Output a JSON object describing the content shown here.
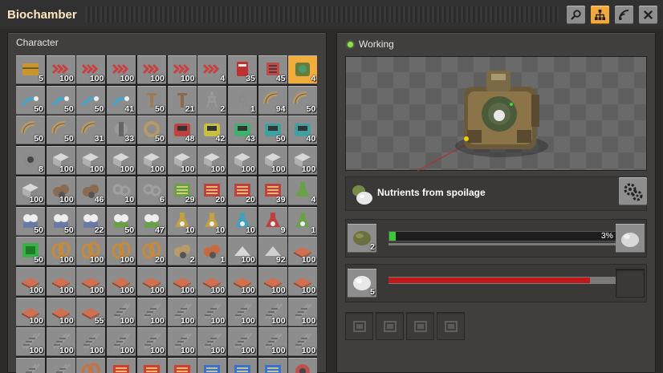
{
  "window": {
    "title": "Biochamber",
    "buttons": [
      {
        "name": "search-button",
        "icon": "magnifier-icon"
      },
      {
        "name": "circuit-network-button",
        "icon": "network-icon",
        "active": true
      },
      {
        "name": "logistics-button",
        "icon": "signal-icon"
      },
      {
        "name": "close-button",
        "icon": "close-icon"
      }
    ]
  },
  "inventory": {
    "title": "Character",
    "slots": [
      {
        "icon": "wooden-chest",
        "color": "#c9962e",
        "count": "5"
      },
      {
        "icon": "transport-belt",
        "color": "#c84040",
        "count": "100"
      },
      {
        "icon": "transport-belt",
        "color": "#c84040",
        "count": "100"
      },
      {
        "icon": "transport-belt",
        "color": "#c84040",
        "count": "100"
      },
      {
        "icon": "transport-belt",
        "color": "#c84040",
        "count": "100"
      },
      {
        "icon": "transport-belt",
        "color": "#c84040",
        "count": "100"
      },
      {
        "icon": "transport-belt",
        "color": "#c84040",
        "count": "4"
      },
      {
        "icon": "splitter",
        "color": "#c03030",
        "count": "35"
      },
      {
        "icon": "underground-belt",
        "color": "#c04a4a",
        "count": "45"
      },
      {
        "icon": "biochamber",
        "color": "#4a9a6a",
        "count": "4",
        "highlight": true
      },
      {
        "icon": "fast-inserter",
        "color": "#3aa8d8",
        "count": "50"
      },
      {
        "icon": "fast-inserter",
        "color": "#3aa8d8",
        "count": "50"
      },
      {
        "icon": "fast-inserter",
        "color": "#3aa8d8",
        "count": "50"
      },
      {
        "icon": "fast-inserter",
        "color": "#3aa8d8",
        "count": "41"
      },
      {
        "icon": "pole",
        "color": "#a07a50",
        "count": "50"
      },
      {
        "icon": "pole",
        "color": "#8a6a48",
        "count": "21"
      },
      {
        "icon": "big-pole",
        "color": "#9a9a9a",
        "count": "2"
      },
      {
        "icon": "big-pole",
        "color": "#8a8a8a",
        "count": "1"
      },
      {
        "icon": "pipe",
        "color": "#b89a68",
        "count": "94"
      },
      {
        "icon": "pipe",
        "color": "#b89a68",
        "count": "50"
      },
      {
        "icon": "pipe",
        "color": "#b89a68",
        "count": "50"
      },
      {
        "icon": "pipe",
        "color": "#b89a68",
        "count": "50"
      },
      {
        "icon": "pipe",
        "color": "#b89a68",
        "count": "31"
      },
      {
        "icon": "pump",
        "color": "#9a9a9a",
        "count": "33"
      },
      {
        "icon": "pipe-ring",
        "color": "#b89a68",
        "count": "50"
      },
      {
        "icon": "assembler",
        "color": "#c04040",
        "count": "48"
      },
      {
        "icon": "assembler",
        "color": "#c8c040",
        "count": "42"
      },
      {
        "icon": "assembler",
        "color": "#40b070",
        "count": "43"
      },
      {
        "icon": "assembler",
        "color": "#40a0a0",
        "count": "50"
      },
      {
        "icon": "assembler",
        "color": "#40a0a0",
        "count": "40"
      },
      {
        "icon": "machine",
        "color": "#8a8a8a",
        "count": "8"
      },
      {
        "icon": "stone-block",
        "color": "#b0b0b0",
        "count": "100"
      },
      {
        "icon": "stone-block",
        "color": "#b0b0b0",
        "count": "100"
      },
      {
        "icon": "stone-block",
        "color": "#b0b0b0",
        "count": "100"
      },
      {
        "icon": "stone-block",
        "color": "#b0b0b0",
        "count": "100"
      },
      {
        "icon": "stone-block",
        "color": "#b0b0b0",
        "count": "100"
      },
      {
        "icon": "stone-block",
        "color": "#b0b0b0",
        "count": "100"
      },
      {
        "icon": "stone-block",
        "color": "#b0b0b0",
        "count": "100"
      },
      {
        "icon": "stone-block",
        "color": "#b0b0b0",
        "count": "100"
      },
      {
        "icon": "stone-block",
        "color": "#b0b0b0",
        "count": "100"
      },
      {
        "icon": "stone-block",
        "color": "#b0b0b0",
        "count": "100"
      },
      {
        "icon": "ore-pile",
        "color": "#8a6a50",
        "count": "100"
      },
      {
        "icon": "ore-pile",
        "color": "#8a6a50",
        "count": "46"
      },
      {
        "icon": "gears",
        "color": "#a0a0a0",
        "count": "10"
      },
      {
        "icon": "gears",
        "color": "#a0a0a0",
        "count": "6"
      },
      {
        "icon": "circuit",
        "color": "#6aa048",
        "count": "29"
      },
      {
        "icon": "circuit",
        "color": "#c04040",
        "count": "20"
      },
      {
        "icon": "circuit",
        "color": "#c04040",
        "count": "20"
      },
      {
        "icon": "circuit",
        "color": "#c04040",
        "count": "39"
      },
      {
        "icon": "science",
        "color": "#6aa048",
        "count": "4"
      },
      {
        "icon": "gear-pack",
        "color": "#6a7aa8",
        "count": "50"
      },
      {
        "icon": "gear-pack",
        "color": "#6a7aa8",
        "count": "50"
      },
      {
        "icon": "gear-pack",
        "color": "#6a7aa8",
        "count": "22"
      },
      {
        "icon": "gear-pack",
        "color": "#6aa048",
        "count": "50"
      },
      {
        "icon": "gear-pack",
        "color": "#6aa048",
        "count": "47"
      },
      {
        "icon": "flask",
        "color": "#c0a040",
        "count": "10"
      },
      {
        "icon": "flask",
        "color": "#c0a040",
        "count": "10"
      },
      {
        "icon": "flask",
        "color": "#40a0c0",
        "count": "10"
      },
      {
        "icon": "flask",
        "color": "#c04040",
        "count": "9"
      },
      {
        "icon": "flask",
        "color": "#6aa048",
        "count": "1"
      },
      {
        "icon": "module",
        "color": "#3ab048",
        "count": "50"
      },
      {
        "icon": "copper-cable",
        "color": "#c88a3a",
        "count": "100"
      },
      {
        "icon": "copper-cable",
        "color": "#c88a3a",
        "count": "100"
      },
      {
        "icon": "copper-cable",
        "color": "#c88a3a",
        "count": "100"
      },
      {
        "icon": "copper-cable",
        "color": "#c88a3a",
        "count": "20"
      },
      {
        "icon": "ore-pile",
        "color": "#b89a68",
        "count": "2"
      },
      {
        "icon": "ore-pile",
        "color": "#c86a40",
        "count": "1"
      },
      {
        "icon": "powder",
        "color": "#d8d8d8",
        "count": "100"
      },
      {
        "icon": "powder",
        "color": "#d0d0d0",
        "count": "92"
      },
      {
        "icon": "plate",
        "color": "#d07050",
        "count": "100"
      },
      {
        "icon": "plate",
        "color": "#d07050",
        "count": "100"
      },
      {
        "icon": "plate",
        "color": "#d07050",
        "count": "100"
      },
      {
        "icon": "plate",
        "color": "#d07050",
        "count": "100"
      },
      {
        "icon": "plate",
        "color": "#d07050",
        "count": "100"
      },
      {
        "icon": "plate",
        "color": "#d07050",
        "count": "100"
      },
      {
        "icon": "plate",
        "color": "#d07050",
        "count": "100"
      },
      {
        "icon": "plate",
        "color": "#d07050",
        "count": "100"
      },
      {
        "icon": "plate",
        "color": "#d07050",
        "count": "100"
      },
      {
        "icon": "plate",
        "color": "#d07050",
        "count": "100"
      },
      {
        "icon": "plate",
        "color": "#d07050",
        "count": "100"
      },
      {
        "icon": "plate",
        "color": "#d07050",
        "count": "100"
      },
      {
        "icon": "plate",
        "color": "#d07050",
        "count": "100"
      },
      {
        "icon": "plate",
        "color": "#d07050",
        "count": "55"
      },
      {
        "icon": "rail",
        "color": "#9a9a9a",
        "count": "100"
      },
      {
        "icon": "rail",
        "color": "#9a9a9a",
        "count": "100"
      },
      {
        "icon": "rail",
        "color": "#9a9a9a",
        "count": "100"
      },
      {
        "icon": "rail",
        "color": "#9a9a9a",
        "count": "100"
      },
      {
        "icon": "rail",
        "color": "#9a9a9a",
        "count": "100"
      },
      {
        "icon": "rail",
        "color": "#9a9a9a",
        "count": "100"
      },
      {
        "icon": "rail",
        "color": "#9a9a9a",
        "count": "100"
      },
      {
        "icon": "rail",
        "color": "#9a9a9a",
        "count": "100"
      },
      {
        "icon": "rail",
        "color": "#9a9a9a",
        "count": "100"
      },
      {
        "icon": "rail",
        "color": "#9a9a9a",
        "count": "100"
      },
      {
        "icon": "rail",
        "color": "#9a9a9a",
        "count": "100"
      },
      {
        "icon": "rail",
        "color": "#9a9a9a",
        "count": "100"
      },
      {
        "icon": "rail",
        "color": "#9a9a9a",
        "count": "100"
      },
      {
        "icon": "rail",
        "color": "#9a9a9a",
        "count": "100"
      },
      {
        "icon": "rail",
        "color": "#9a9a9a",
        "count": "100"
      },
      {
        "icon": "rail",
        "color": "#9a9a9a",
        "count": "100"
      },
      {
        "icon": "rail",
        "color": "#9a9a9a",
        "count": "100"
      },
      {
        "icon": "rail",
        "color": "#9a9a9a",
        "count": ""
      },
      {
        "icon": "rail",
        "color": "#9a9a9a",
        "count": ""
      },
      {
        "icon": "copper-cable",
        "color": "#c87040",
        "count": ""
      },
      {
        "icon": "circuit",
        "color": "#d04030",
        "count": ""
      },
      {
        "icon": "circuit",
        "color": "#d04030",
        "count": ""
      },
      {
        "icon": "circuit",
        "color": "#d04030",
        "count": ""
      },
      {
        "icon": "circuit",
        "color": "#3a70d0",
        "count": ""
      },
      {
        "icon": "circuit",
        "color": "#3a70d0",
        "count": ""
      },
      {
        "icon": "circuit",
        "color": "#3a70d0",
        "count": ""
      },
      {
        "icon": "machine",
        "color": "#c05050",
        "count": ""
      }
    ]
  },
  "machine": {
    "status": "Working",
    "status_color": "#8ee04a",
    "recipe": {
      "name": "Nutrients from spoilage",
      "icon": "nutrients-icon"
    },
    "input": {
      "icon": "spoilage-icon",
      "count": "2",
      "progress_percent": 3,
      "progress_label": "3%",
      "bonus_progress": 0
    },
    "fuel": {
      "icon": "nutrients-icon",
      "count": "5",
      "level_percent": 88
    },
    "output": {
      "icon": "nutrients-icon"
    },
    "module_slots": 4
  }
}
